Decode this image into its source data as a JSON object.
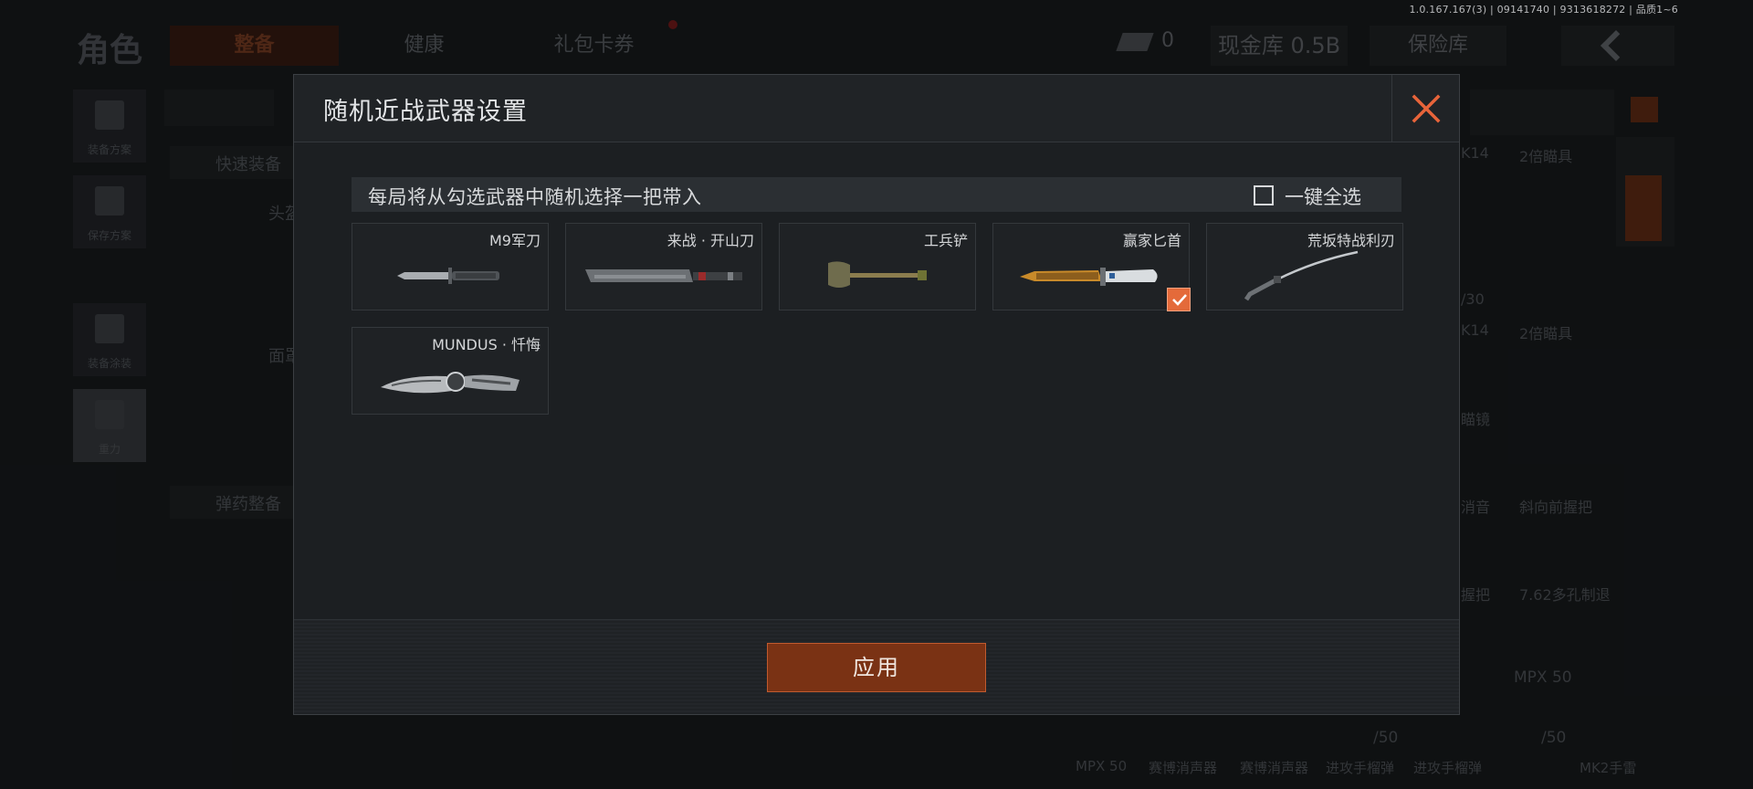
{
  "version": "1.0.167.167(3) | 09141740 | 9313618272 | 品质1~6",
  "background": {
    "page_title": "角色",
    "tabs": [
      {
        "label": "整备",
        "active": true
      },
      {
        "label": "健康",
        "active": false
      },
      {
        "label": "礼包卡券",
        "active": false
      }
    ],
    "ticket_count": "0",
    "cash_label": "现金库 0.5B",
    "vault_label": "保险库",
    "rail": [
      {
        "label": "装备方案"
      },
      {
        "label": "保存方案"
      },
      {
        "label": "装备涂装"
      },
      {
        "label": "重力"
      }
    ],
    "quick_equip": "快速装备",
    "ammo_prep": "弹药整备",
    "side_labels": [
      "头盔",
      "面罩"
    ],
    "right_texts": [
      "K14",
      "2倍瞄具",
      "/30",
      "K14",
      "2倍瞄具",
      "瞄镜",
      "消音",
      "斜向前握把",
      "握把",
      "7.62多孔制退",
      "MPX 50",
      "/50",
      "/50",
      "MPX 50",
      "赛博消声器",
      "赛博消声器",
      "进攻手榴弹",
      "进攻手榴弹",
      "MK2手雷"
    ]
  },
  "modal": {
    "title": "随机近战武器设置",
    "hint": "每局将从勾选武器中随机选择一把带入",
    "select_all_label": "一键全选",
    "select_all_checked": false,
    "weapons": [
      {
        "name": "M9军刀",
        "icon": "bayonet-icon",
        "checked": false
      },
      {
        "name": "来战 · 开山刀",
        "icon": "machete-icon",
        "checked": false
      },
      {
        "name": "工兵铲",
        "icon": "shovel-icon",
        "checked": false
      },
      {
        "name": "赢家匕首",
        "icon": "golden-dagger-icon",
        "checked": true
      },
      {
        "name": "荒坂特战利刃",
        "icon": "katana-icon",
        "checked": false
      },
      {
        "name": "MUNDUS · 忏悔",
        "icon": "ornate-knife-icon",
        "checked": false
      }
    ],
    "apply_label": "应用",
    "accent_color": "#e46a3a",
    "apply_color": "#7a3214"
  }
}
